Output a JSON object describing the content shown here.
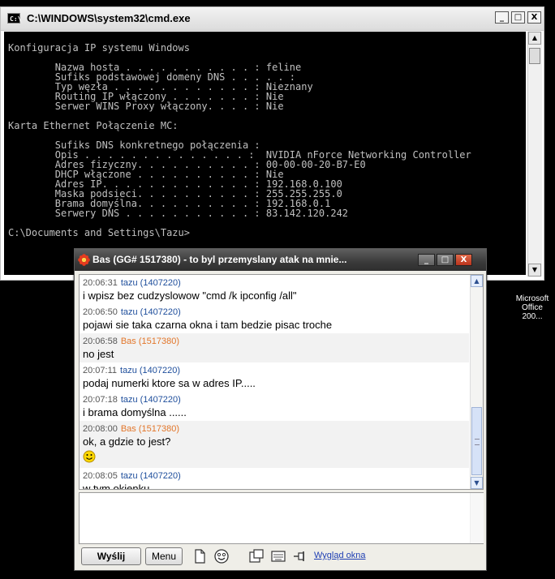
{
  "desktop": {
    "fragments": [
      "Microsoft",
      "Office 200..."
    ]
  },
  "cmd": {
    "title": "C:\\WINDOWS\\system32\\cmd.exe",
    "icon_text": "C:\\",
    "buttons": {
      "minimize": "_",
      "maximize": "□",
      "close": "X"
    },
    "lines": [
      "Konfiguracja IP systemu Windows",
      "",
      "        Nazwa hosta . . . . . . . . . . . : feline",
      "        Sufiks podstawowej domeny DNS . . . . . :",
      "        Typ węzła . . . . . . . . . . . . : Nieznany",
      "        Routing IP włączony . . . . . . . : Nie",
      "        Serwer WINS Proxy włączony. . . . : Nie",
      "",
      "Karta Ethernet Połączenie MC:",
      "",
      "        Sufiks DNS konkretnego połączenia :",
      "        Opis . . . . . . . . . . . . . . :  NVIDIA nForce Networking Controller",
      "        Adres fizyczny. . . . . . . . . . : 00-00-00-20-B7-E0",
      "        DHCP włączone . . . . . . . . . . : Nie",
      "        Adres IP. . . . . . . . . . . . . : 192.168.0.100",
      "        Maska podsieci. . . . . . . . . . : 255.255.255.0",
      "        Brama domyślna. . . . . . . . . . : 192.168.0.1",
      "        Serwery DNS . . . . . . . . . . . : 83.142.120.242",
      "",
      "C:\\Documents and Settings\\Tazu>"
    ]
  },
  "gg": {
    "title": "Bas (GG# 1517380) - to byl przemyslany atak na mnie...",
    "buttons": {
      "minimize": "_",
      "maximize": "□",
      "close": "X"
    },
    "messages": [
      {
        "time": "20:06:31",
        "sender": "tazu (1407220)",
        "text": "i wpisz bez cudzyslowow \"cmd /k ipconfig /all\""
      },
      {
        "time": "20:06:50",
        "sender": "tazu (1407220)",
        "text": "pojawi sie taka czarna okna i tam bedzie pisac troche"
      },
      {
        "time": "20:06:58",
        "sender": "Bas (1517380)",
        "text": "no jest"
      },
      {
        "time": "20:07:11",
        "sender": "tazu (1407220)",
        "text": "podaj numerki ktore sa w adres IP....."
      },
      {
        "time": "20:07:18",
        "sender": "tazu (1407220)",
        "text": "i brama domyślna ......"
      },
      {
        "time": "20:08:00",
        "sender": "Bas (1517380)",
        "text": "ok, a gdzie to jest?",
        "emoticon": "smiley-icon"
      },
      {
        "time": "20:08:05",
        "sender": "tazu (1407220)",
        "text": "w tym okienku"
      }
    ],
    "toolbar": {
      "send_label": "Wyślij",
      "menu_label": "Menu",
      "appearance_link": "Wygląd okna",
      "icons": [
        "send-file-icon",
        "emoticons-icon",
        "picture-icon",
        "keyboard-icon",
        "pin-icon"
      ]
    },
    "colors": {
      "self_sender": "#1d4d9b",
      "other_sender": "#e2762a",
      "link": "#1f3fb3"
    }
  }
}
